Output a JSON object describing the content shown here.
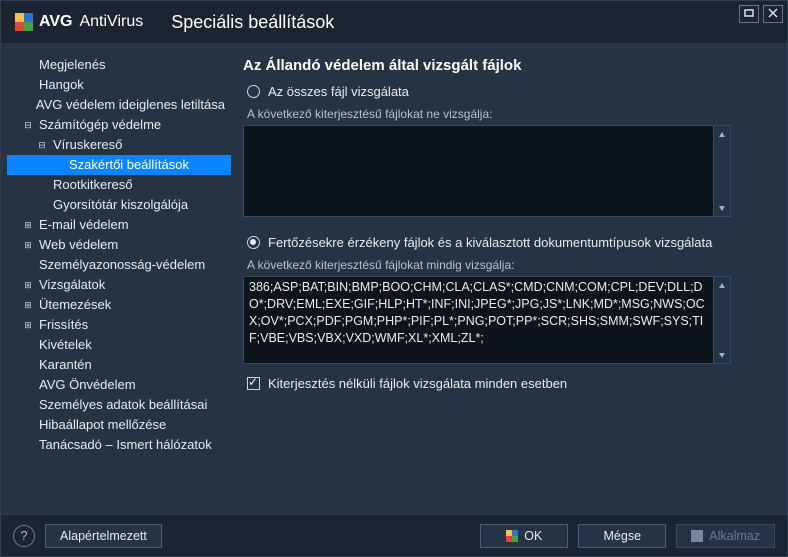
{
  "brand": {
    "name": "AVG",
    "sub": "AntiVirus"
  },
  "title": "Speciális beállítások",
  "sidebar": {
    "items": [
      {
        "label": "Megjelenés",
        "indent": 0,
        "toggler": ""
      },
      {
        "label": "Hangok",
        "indent": 0,
        "toggler": ""
      },
      {
        "label": "AVG védelem ideiglenes letiltása",
        "indent": 0,
        "toggler": ""
      },
      {
        "label": "Számítógép védelme",
        "indent": 0,
        "toggler": "−"
      },
      {
        "label": "Víruskereső",
        "indent": 1,
        "toggler": "−"
      },
      {
        "label": "Szakértői beállítások",
        "indent": 2,
        "toggler": "",
        "selected": true
      },
      {
        "label": "Rootkitkereső",
        "indent": 1,
        "toggler": ""
      },
      {
        "label": "Gyorsítótár kiszolgálója",
        "indent": 1,
        "toggler": ""
      },
      {
        "label": "E-mail védelem",
        "indent": 0,
        "toggler": "+"
      },
      {
        "label": "Web védelem",
        "indent": 0,
        "toggler": "+"
      },
      {
        "label": "Személyazonosság-védelem",
        "indent": 0,
        "toggler": ""
      },
      {
        "label": "Vizsgálatok",
        "indent": 0,
        "toggler": "+"
      },
      {
        "label": "Ütemezések",
        "indent": 0,
        "toggler": "+"
      },
      {
        "label": "Frissítés",
        "indent": 0,
        "toggler": "+"
      },
      {
        "label": "Kivételek",
        "indent": 0,
        "toggler": ""
      },
      {
        "label": "Karantén",
        "indent": 0,
        "toggler": ""
      },
      {
        "label": "AVG Önvédelem",
        "indent": 0,
        "toggler": ""
      },
      {
        "label": "Személyes adatok beállításai",
        "indent": 0,
        "toggler": ""
      },
      {
        "label": "Hibaállapot mellőzése",
        "indent": 0,
        "toggler": ""
      },
      {
        "label": "Tanácsadó – Ismert hálózatok",
        "indent": 0,
        "toggler": ""
      }
    ]
  },
  "main": {
    "heading": "Az Állandó védelem által vizsgált fájlok",
    "radio_all": "Az összes fájl vizsgálata",
    "exclude_label": "A következő kiterjesztésű fájlokat ne vizsgálja:",
    "exclude_value": "",
    "radio_sensitive": "Fertőzésekre érzékeny fájlok és a kiválasztott dokumentumtípusok vizsgálata",
    "include_label": "A következő kiterjesztésű fájlokat mindig vizsgálja:",
    "include_value": "386;ASP;BAT;BIN;BMP;BOO;CHM;CLA;CLAS*;CMD;CNM;COM;CPL;DEV;DLL;DO*;DRV;EML;EXE;GIF;HLP;HT*;INF;INI;JPEG*;JPG;JS*;LNK;MD*;MSG;NWS;OCX;OV*;PCX;PDF;PGM;PHP*;PIF;PL*;PNG;POT;PP*;SCR;SHS;SMM;SWF;SYS;TIF;VBE;VBS;VBX;VXD;WMF;XL*;XML;ZL*;",
    "check_noext": "Kiterjesztés nélküli fájlok vizsgálata minden esetben"
  },
  "footer": {
    "default": "Alapértelmezett",
    "ok": "OK",
    "cancel": "Mégse",
    "apply": "Alkalmaz"
  }
}
